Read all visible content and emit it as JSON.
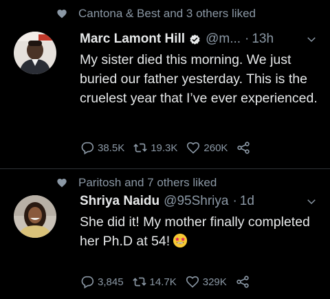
{
  "tweets": [
    {
      "social_context": "Cantona & Best and 3 others liked",
      "name": "Marc Lamont Hill",
      "verified": true,
      "handle": "@m...",
      "time": "13h",
      "text": "My sister died this morning. We just buried our father yesterday. This is the cruelest year that I’ve ever experienced.",
      "replies": "38.5K",
      "retweets": "19.3K",
      "likes": "260K"
    },
    {
      "social_context": "Paritosh and 7 others liked",
      "name": "Shriya Naidu",
      "verified": false,
      "handle": "@95Shriya",
      "time": "1d",
      "text": "She did it! My mother finally completed her Ph.D at 54!",
      "replies": "3,845",
      "retweets": "14.7K",
      "likes": "329K"
    }
  ],
  "separator": "·",
  "colors": {
    "background": "#000000",
    "text": "#e7e9ea",
    "secondary": "#8b98a5",
    "verified": "#e7e9ea",
    "divider": "#2f3336"
  },
  "icons": {
    "social": "heart-icon",
    "reply": "reply-icon",
    "retweet": "retweet-icon",
    "like": "heart-outline-icon",
    "share": "share-icon",
    "menu": "chevron-down-icon",
    "emoji": "star-struck-emoji"
  }
}
